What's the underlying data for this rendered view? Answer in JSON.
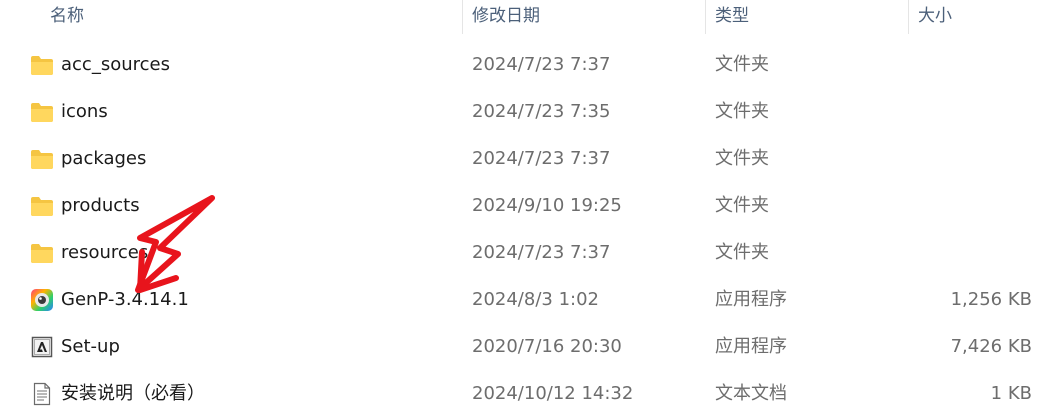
{
  "columns": {
    "name": "名称",
    "date": "修改日期",
    "type": "类型",
    "size": "大小"
  },
  "files": [
    {
      "name": "acc_sources",
      "date": "2024/7/23 7:37",
      "type": "文件夹",
      "size": "",
      "icon": "folder-icon"
    },
    {
      "name": "icons",
      "date": "2024/7/23 7:35",
      "type": "文件夹",
      "size": "",
      "icon": "folder-icon"
    },
    {
      "name": "packages",
      "date": "2024/7/23 7:37",
      "type": "文件夹",
      "size": "",
      "icon": "folder-icon"
    },
    {
      "name": "products",
      "date": "2024/9/10 19:25",
      "type": "文件夹",
      "size": "",
      "icon": "folder-icon"
    },
    {
      "name": "resources",
      "date": "2024/7/23 7:37",
      "type": "文件夹",
      "size": "",
      "icon": "folder-icon"
    },
    {
      "name": "GenP-3.4.14.1",
      "date": "2024/8/3 1:02",
      "type": "应用程序",
      "size": "1,256 KB",
      "icon": "genp-app-icon"
    },
    {
      "name": "Set-up",
      "date": "2020/7/16 20:30",
      "type": "应用程序",
      "size": "7,426 KB",
      "icon": "adobe-setup-icon"
    },
    {
      "name": "安装说明（必看）",
      "date": "2024/10/12 14:32",
      "type": "文本文档",
      "size": "1 KB",
      "icon": "text-document-icon"
    }
  ],
  "colors": {
    "folder": "#f5c542",
    "arrow": "#e8141c",
    "header_text": "#4c607a"
  }
}
